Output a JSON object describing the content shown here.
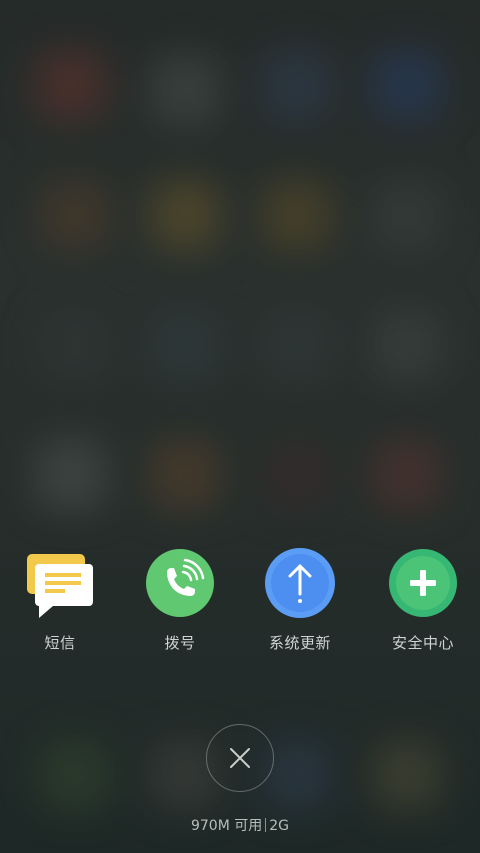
{
  "recent_apps": [
    {
      "label": "短信",
      "icon": "message-icon",
      "color": "#f6c94a"
    },
    {
      "label": "拨号",
      "icon": "phone-icon",
      "color": "#5fc870"
    },
    {
      "label": "系统更新",
      "icon": "update-arrow-icon",
      "color": "#5b9cf5"
    },
    {
      "label": "安全中心",
      "icon": "security-plus-icon",
      "color": "#37b774"
    }
  ],
  "close_button": {
    "icon": "close-icon"
  },
  "memory": {
    "available": "970M 可用",
    "total": "2G"
  }
}
